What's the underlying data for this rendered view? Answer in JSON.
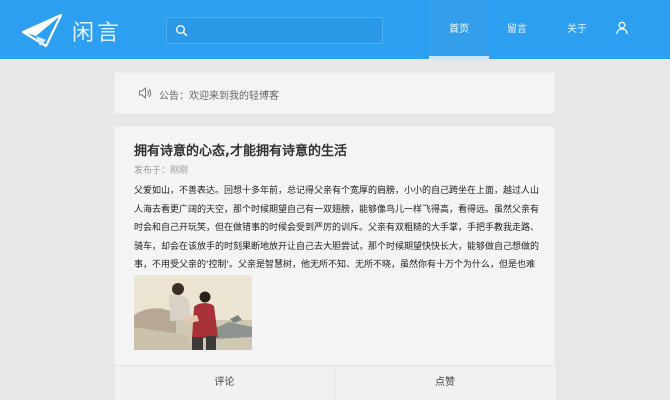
{
  "header": {
    "brand": "闲言",
    "search_placeholder": "",
    "nav": [
      {
        "label": "首页",
        "active": true
      },
      {
        "label": "留言",
        "active": false
      },
      {
        "label": "关于",
        "active": false
      }
    ],
    "accent_color": "#2d9ff0"
  },
  "notice": {
    "text": "公告：欢迎来到我的轻博客"
  },
  "post": {
    "title": "拥有诗意的心态,才能拥有诗意的生活",
    "meta": "发布于：刚刚",
    "body": "父爱如山，不善表达。回想十多年前，总记得父亲有个宽厚的肩膀，小小的自己跨坐在上面，越过人山人海去看更广阔的天空，那个时候期望自己有一双翅膀，能够像鸟儿一样飞得高，看得远。虽然父亲有时会和自己开玩笑，但在做错事的时候会受到严厉的训斥。父亲有双粗糙的大手掌，手把手教我走路、骑车，却会在该放手的时刻果断地放开让自己去大胆尝试，那个时候期望快快长大，能够做自己想做的事，不用受父亲的'控制'。父亲是智慧树，他无所不知、无所不晓，虽然你有十万个为什么，但是也难不倒他。",
    "comment_label": "评论",
    "like_label": "点赞"
  }
}
